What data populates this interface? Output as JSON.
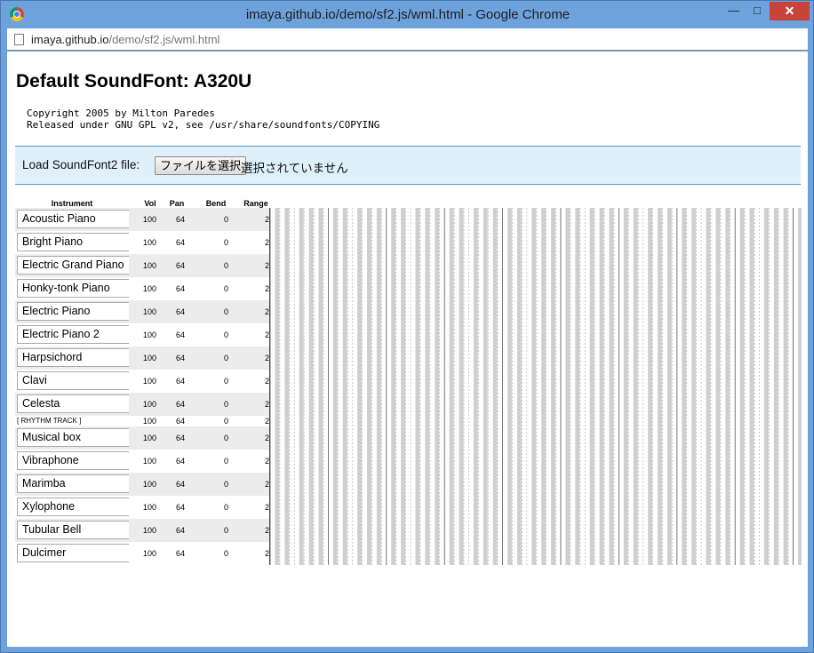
{
  "window": {
    "title": "imaya.github.io/demo/sf2.js/wml.html - Google Chrome",
    "minimize": "—",
    "maximize": "□",
    "close": "✕",
    "icon": "chrome-icon"
  },
  "address": {
    "host": "imaya.github.io",
    "path": "/demo/sf2.js/wml.html"
  },
  "page": {
    "title": "Default SoundFont: A320U",
    "copyright": "Copyright 2005 by Milton Paredes\nReleased under GNU GPL v2, see /usr/share/soundfonts/COPYING",
    "load_label": "Load SoundFont2 file:",
    "file_button": "ファイルを選択",
    "no_file": "選択されていません"
  },
  "table": {
    "headers": {
      "instrument": "Instrument",
      "vol": "Vol",
      "pan": "Pan",
      "bend": "Bend",
      "range": "Range"
    },
    "rows": [
      {
        "instrument": "Acoustic Piano",
        "vol": "100",
        "pan": "64",
        "bend": "0",
        "range": "2"
      },
      {
        "instrument": "Bright Piano",
        "vol": "100",
        "pan": "64",
        "bend": "0",
        "range": "2"
      },
      {
        "instrument": "Electric Grand Piano",
        "vol": "100",
        "pan": "64",
        "bend": "0",
        "range": "2"
      },
      {
        "instrument": "Honky-tonk Piano",
        "vol": "100",
        "pan": "64",
        "bend": "0",
        "range": "2"
      },
      {
        "instrument": "Electric Piano",
        "vol": "100",
        "pan": "64",
        "bend": "0",
        "range": "2"
      },
      {
        "instrument": "Electric Piano 2",
        "vol": "100",
        "pan": "64",
        "bend": "0",
        "range": "2"
      },
      {
        "instrument": "Harpsichord",
        "vol": "100",
        "pan": "64",
        "bend": "0",
        "range": "2"
      },
      {
        "instrument": "Clavi",
        "vol": "100",
        "pan": "64",
        "bend": "0",
        "range": "2"
      },
      {
        "instrument": "Celesta",
        "vol": "100",
        "pan": "64",
        "bend": "0",
        "range": "2"
      },
      {
        "instrument": "[ RHYTHM TRACK ]",
        "vol": "100",
        "pan": "64",
        "bend": "0",
        "range": "2",
        "rhythm": true
      },
      {
        "instrument": "Musical box",
        "vol": "100",
        "pan": "64",
        "bend": "0",
        "range": "2"
      },
      {
        "instrument": "Vibraphone",
        "vol": "100",
        "pan": "64",
        "bend": "0",
        "range": "2"
      },
      {
        "instrument": "Marimba",
        "vol": "100",
        "pan": "64",
        "bend": "0",
        "range": "2"
      },
      {
        "instrument": "Xylophone",
        "vol": "100",
        "pan": "64",
        "bend": "0",
        "range": "2"
      },
      {
        "instrument": "Tubular Bell",
        "vol": "100",
        "pan": "64",
        "bend": "0",
        "range": "2"
      },
      {
        "instrument": "Dulcimer",
        "vol": "100",
        "pan": "64",
        "bend": "0",
        "range": "2"
      }
    ]
  },
  "keyboard": {
    "icon": "piano-keyboard-icon",
    "white_key_color": "#ffffff",
    "black_key_color": "#cfcfcf"
  }
}
